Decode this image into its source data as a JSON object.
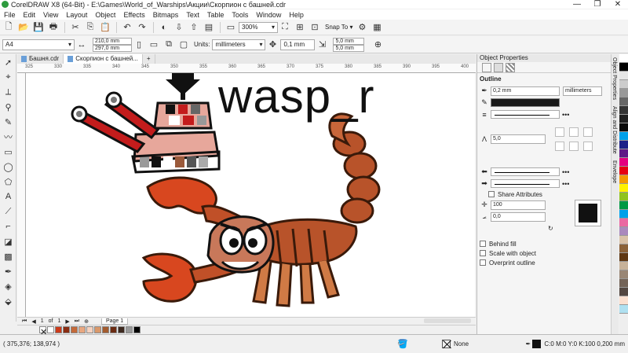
{
  "window": {
    "title": "CorelDRAW X8 (64-Bit) - E:\\Games\\World_of_Warships\\Акции\\Скорпион с башней.cdr",
    "controls": [
      "—",
      "❐",
      "✕"
    ]
  },
  "menu": [
    "File",
    "Edit",
    "View",
    "Layout",
    "Object",
    "Effects",
    "Bitmaps",
    "Text",
    "Table",
    "Tools",
    "Window",
    "Help"
  ],
  "std_toolbar": {
    "zoom": "300%",
    "snap": "Snap To"
  },
  "prop_bar": {
    "page_size": "A4",
    "width": "210,0 mm",
    "height": "297,0 mm",
    "units_label": "Units:",
    "units": "millimeters",
    "nudge": "0,1 mm",
    "dup_x": "5,0 mm",
    "dup_y": "5,0 mm"
  },
  "tabs": [
    "Башня.cdr",
    "Скорпион с башней...",
    "+"
  ],
  "ruler": [
    "325",
    "330",
    "335",
    "340",
    "345",
    "350",
    "355",
    "360",
    "365",
    "370",
    "375",
    "380",
    "385",
    "390",
    "395",
    "400"
  ],
  "canvas": {
    "text": "wasp_r"
  },
  "page_nav": {
    "current": "1",
    "of": "of",
    "total": "1",
    "page_tab": "Page 1"
  },
  "doc_palette": [
    "#ffffff",
    "#cc3a1a",
    "#8b2d12",
    "#c46a3a",
    "#e8a780",
    "#f6d2bf",
    "#d9986b",
    "#a35b2f",
    "#6b2b12",
    "#3e2a20",
    "#999999",
    "#000000"
  ],
  "status": {
    "coords": "( 375,376; 138,974 )",
    "fill": "None",
    "outline": "C:0 M:0 Y:0 K:100  0,200 mm"
  },
  "panel": {
    "title": "Object Properties",
    "section": "Outline",
    "width": "0,2 mm",
    "units": "millimeters",
    "miter": "5,0",
    "share_attrs": "Share Attributes",
    "stretch": "100",
    "angle": "0,0",
    "behind_fill": "Behind fill",
    "scale_with_object": "Scale with object",
    "overprint": "Overprint outline",
    "outline_color": "#111111"
  },
  "docker_tabs": [
    "Object Properties",
    "Align and Distribute",
    "Envelope"
  ],
  "palette": [
    "#ffffff",
    "#000000",
    "#e6e6e6",
    "#cccccc",
    "#999999",
    "#666666",
    "#333333",
    "#1f1f1f",
    "#0a0a0a",
    "#00a0e9",
    "#1d2088",
    "#601986",
    "#e4007f",
    "#e60012",
    "#f39800",
    "#fff100",
    "#8fc31f",
    "#009944",
    "#00a0e9",
    "#ea68a2",
    "#aa89bd",
    "#d9c2a8",
    "#8c6239",
    "#603813",
    "#c7b299",
    "#998675",
    "#736357",
    "#534741",
    "#fbe0d0",
    "#b0e0f0"
  ]
}
